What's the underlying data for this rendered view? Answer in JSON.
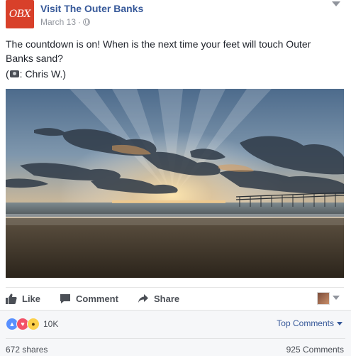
{
  "post": {
    "page_name": "Visit The Outer Banks",
    "logo_text": "OBX",
    "date": "March 13",
    "separator": "·",
    "text": "The countdown is on! When is the next time your feet will touch Outer Banks sand?",
    "credit_open": "(",
    "credit_text": ": Chris W.)",
    "icons": [
      "globe-icon",
      "camera-icon",
      "chevron-down-icon"
    ]
  },
  "actions": {
    "like_label": "Like",
    "comment_label": "Comment",
    "share_label": "Share"
  },
  "reactions": {
    "count": "10K",
    "types": [
      "like",
      "love",
      "wow"
    ],
    "top_comments_label": "Top Comments",
    "shares": "672 shares",
    "comments": "925 Comments"
  },
  "colors": {
    "link_blue": "#365899",
    "logo_red": "#d8402a",
    "action_gray": "#4b4f56",
    "muted_gray": "#90949c"
  }
}
